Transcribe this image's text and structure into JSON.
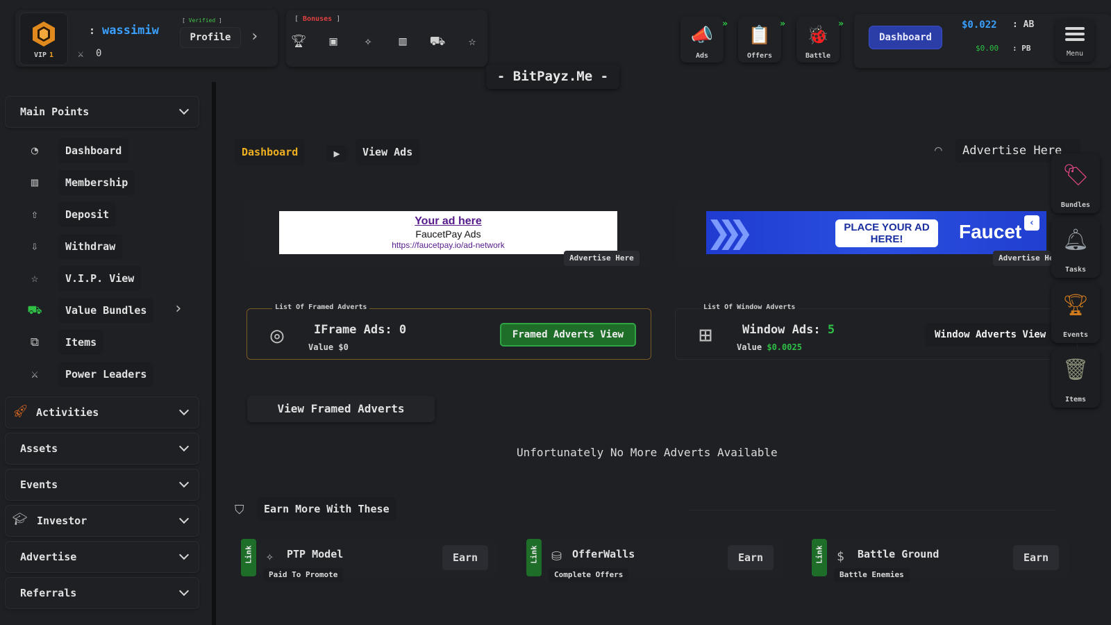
{
  "user": {
    "vip_label": "VIP",
    "vip_level": "1",
    "name_prefix": ":",
    "username": "wassimiw",
    "power": "0",
    "verified": "Verified",
    "profile_label": "Profile"
  },
  "bonuses": {
    "label": "Bonuses",
    "icons": [
      "trophy-icon",
      "ticket-icon",
      "sparkles-icon",
      "chart-icon",
      "cart-icon",
      "star-icon"
    ]
  },
  "site_title": "- BitPayz.Me -",
  "quick": [
    {
      "label": "Ads",
      "icon": "megaphone-icon"
    },
    {
      "label": "Offers",
      "icon": "clipboard-icon"
    },
    {
      "label": "Battle",
      "icon": "bug-icon"
    }
  ],
  "header": {
    "dashboard_btn": "Dashboard",
    "balance_ab": "$0.022",
    "balance_ab_label": ": AB",
    "balance_pb": "$0.00",
    "balance_pb_label": ": PB",
    "menu_label": "Menu"
  },
  "sidebar": {
    "main_points": "Main Points",
    "items": [
      {
        "label": "Dashboard",
        "icon": "gauge-icon"
      },
      {
        "label": "Membership",
        "icon": "bar-chart-icon"
      },
      {
        "label": "Deposit",
        "icon": "upload-icon"
      },
      {
        "label": "Withdraw",
        "icon": "download-icon"
      },
      {
        "label": "V.I.P. View",
        "icon": "star-icon"
      },
      {
        "label": "Value Bundles",
        "icon": "cart-icon"
      },
      {
        "label": "Items",
        "icon": "items-icon"
      },
      {
        "label": "Power Leaders",
        "icon": "swords-icon"
      }
    ],
    "groups": [
      "Activities",
      "Assets",
      "Events",
      "Investor",
      "Advertise",
      "Referrals"
    ]
  },
  "breadcrumb": {
    "home": "Dashboard",
    "current": "View Ads"
  },
  "advertise_here_top": "Advertise Here",
  "ads": {
    "left_line1": "Your ad here",
    "left_line2": "FaucetPay Ads",
    "left_line3": "https://faucetpay.io/ad-network",
    "left_badge": "Advertise Here",
    "right_place": "PLACE YOUR AD HERE!",
    "right_brand": "Faucet",
    "right_badge": "Advertise Here"
  },
  "framed": {
    "caption": "List Of Framed Adverts",
    "title": "IFrame Ads:",
    "count": "0",
    "value_label": "Value",
    "value": "$0",
    "button": "Framed Adverts View"
  },
  "window": {
    "caption": "List Of Window Adverts",
    "title": "Window Ads:",
    "count": "5",
    "value_label": "Value",
    "value": "$0.0025",
    "button": "Window Adverts View"
  },
  "view_framed_btn": "View Framed Adverts",
  "no_more": "Unfortunately No More Adverts Available",
  "earn": {
    "title": "Earn More With These",
    "cards": [
      {
        "link": "Link",
        "title": "PTP Model",
        "sub": "Paid To Promote",
        "btn": "Earn"
      },
      {
        "link": "Link",
        "title": "OfferWalls",
        "sub": "Complete Offers",
        "btn": "Earn"
      },
      {
        "link": "Link",
        "title": "Battle Ground",
        "sub": "Battle Enemies",
        "btn": "Earn"
      }
    ]
  },
  "rail": [
    {
      "label": "Bundles",
      "icon": "bundles-icon"
    },
    {
      "label": "Tasks",
      "icon": "bell-icon"
    },
    {
      "label": "Events",
      "icon": "trophy-icon"
    },
    {
      "label": "Items",
      "icon": "trash-can-icon"
    }
  ],
  "colors": {
    "background": "#1e2024",
    "accent_blue": "#3aa0ff",
    "accent_green": "#2fa545",
    "accent_gold": "#f0b020"
  }
}
